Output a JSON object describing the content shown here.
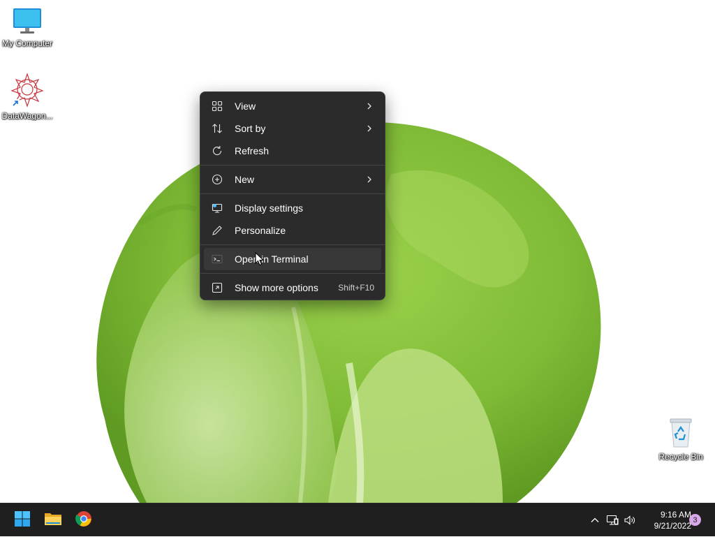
{
  "desktop": {
    "icons": [
      {
        "label": "My Computer",
        "icon": "monitor-icon"
      },
      {
        "label": "DataWagon...",
        "icon": "datawagon-app-icon"
      },
      {
        "label": "Recycle Bin",
        "icon": "recycle-bin-icon"
      }
    ]
  },
  "context_menu": {
    "items": [
      {
        "label": "View",
        "icon": "grid-icon",
        "submenu": true
      },
      {
        "label": "Sort by",
        "icon": "sort-arrows-icon",
        "submenu": true
      },
      {
        "label": "Refresh",
        "icon": "refresh-icon",
        "submenu": false
      },
      {
        "label": "New",
        "icon": "plus-circle-icon",
        "submenu": true
      },
      {
        "label": "Display settings",
        "icon": "display-settings-icon",
        "submenu": false
      },
      {
        "label": "Personalize",
        "icon": "pen-icon",
        "submenu": false
      },
      {
        "label": "Open in Terminal",
        "icon": "terminal-icon",
        "submenu": false
      },
      {
        "label": "Show more options",
        "icon": "expand-icon",
        "shortcut": "Shift+F10"
      }
    ]
  },
  "taskbar": {
    "apps": [
      {
        "name": "Start",
        "icon": "windows-start-icon"
      },
      {
        "name": "File Explorer",
        "icon": "folder-icon"
      },
      {
        "name": "Google Chrome",
        "icon": "chrome-icon"
      }
    ],
    "tray": {
      "icons": [
        "chevron-up-icon",
        "network-icon",
        "volume-icon"
      ],
      "time": "9:16 AM",
      "date": "9/21/2022",
      "notification_count": "3"
    }
  },
  "colors": {
    "menu_bg": "#2b2b2b",
    "menu_hover": "#383838",
    "taskbar_bg": "#1f1f1f",
    "accent": "#4cc2ff",
    "lettuce": "#8cc63f"
  }
}
